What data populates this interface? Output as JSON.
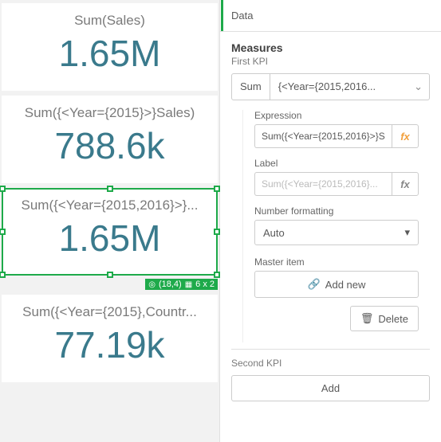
{
  "kpis": [
    {
      "title": "Sum(Sales)",
      "value": "1.65M"
    },
    {
      "title": "Sum({<Year={2015}>}Sales)",
      "value": "788.6k"
    },
    {
      "title": "Sum({<Year={2015,2016}>}...",
      "value": "1.65M",
      "selected": true,
      "badge_pos": "(18,4)",
      "badge_size": "6 x 2"
    },
    {
      "title": "Sum({<Year={2015},Countr...",
      "value": "77.19k"
    }
  ],
  "panel": {
    "tab": "Data",
    "measures_title": "Measures",
    "first_kpi_label": "First KPI",
    "agg": "Sum",
    "field": "{<Year={2015,2016...",
    "expression_label": "Expression",
    "expression_value": "Sum({<Year={2015,2016}>}S",
    "label_label": "Label",
    "label_placeholder": "Sum({<Year={2015,2016}...",
    "number_formatting_label": "Number formatting",
    "number_formatting_value": "Auto",
    "master_item_label": "Master item",
    "add_new": "Add new",
    "delete": "Delete",
    "second_kpi_label": "Second KPI",
    "add": "Add"
  }
}
